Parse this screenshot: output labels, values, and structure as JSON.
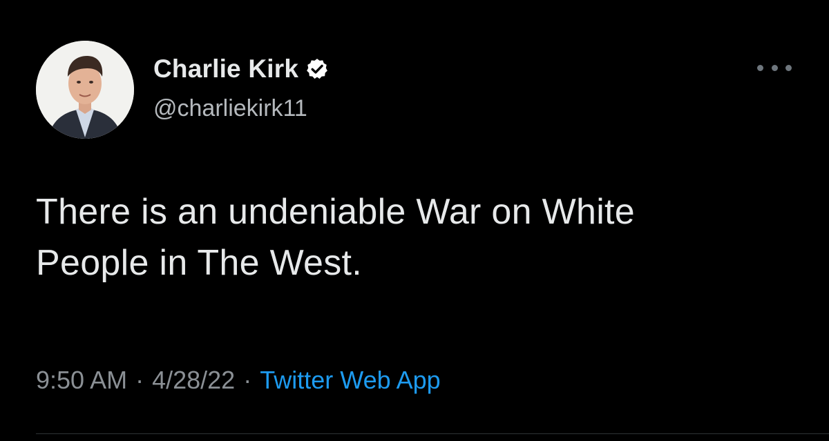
{
  "tweet": {
    "author": {
      "display_name": "Charlie Kirk",
      "handle": "@charliekirk11",
      "verified": true,
      "avatar_icon": "profile-photo"
    },
    "text_lines": [
      "There is an undeniable War on White",
      "People in The West."
    ],
    "time": "9:50 AM",
    "date": "4/28/22",
    "separator": "·",
    "source": "Twitter Web App",
    "more_icon": "more-options-icon"
  },
  "colors": {
    "background": "#000000",
    "primary_text": "#e7e9ea",
    "secondary_text": "#8b9095",
    "link": "#1d9bf0",
    "verified_badge": "#ffffff"
  }
}
